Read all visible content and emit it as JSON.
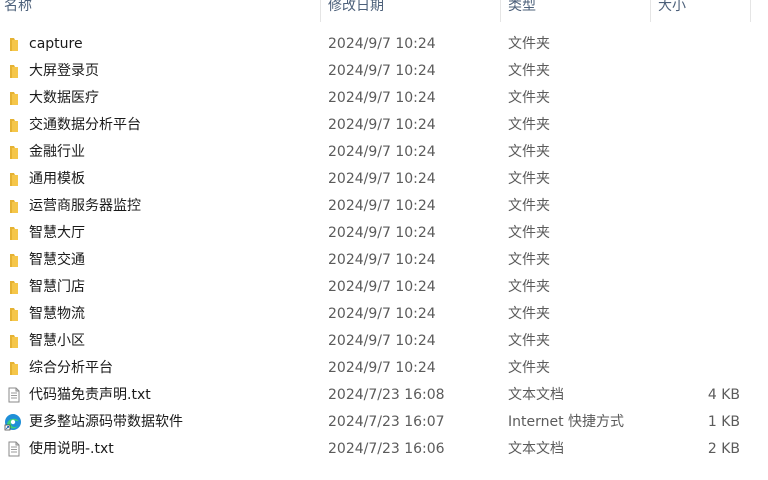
{
  "columns": {
    "name": "名称",
    "date": "修改日期",
    "type": "类型",
    "size": "大小"
  },
  "colors": {
    "folder": "#f5c64a",
    "folder_tab": "#e5b233",
    "header_text": "#4c607a",
    "secondary_text": "#5b5b5b"
  },
  "rows": [
    {
      "name": "capture",
      "date": "2024/9/7 10:24",
      "type": "文件夹",
      "size": "",
      "icon": "folder-icon"
    },
    {
      "name": "大屏登录页",
      "date": "2024/9/7 10:24",
      "type": "文件夹",
      "size": "",
      "icon": "folder-icon"
    },
    {
      "name": "大数据医疗",
      "date": "2024/9/7 10:24",
      "type": "文件夹",
      "size": "",
      "icon": "folder-icon"
    },
    {
      "name": "交通数据分析平台",
      "date": "2024/9/7 10:24",
      "type": "文件夹",
      "size": "",
      "icon": "folder-icon"
    },
    {
      "name": "金融行业",
      "date": "2024/9/7 10:24",
      "type": "文件夹",
      "size": "",
      "icon": "folder-icon"
    },
    {
      "name": "通用模板",
      "date": "2024/9/7 10:24",
      "type": "文件夹",
      "size": "",
      "icon": "folder-icon"
    },
    {
      "name": "运营商服务器监控",
      "date": "2024/9/7 10:24",
      "type": "文件夹",
      "size": "",
      "icon": "folder-icon"
    },
    {
      "name": "智慧大厅",
      "date": "2024/9/7 10:24",
      "type": "文件夹",
      "size": "",
      "icon": "folder-icon"
    },
    {
      "name": "智慧交通",
      "date": "2024/9/7 10:24",
      "type": "文件夹",
      "size": "",
      "icon": "folder-icon"
    },
    {
      "name": "智慧门店",
      "date": "2024/9/7 10:24",
      "type": "文件夹",
      "size": "",
      "icon": "folder-icon"
    },
    {
      "name": "智慧物流",
      "date": "2024/9/7 10:24",
      "type": "文件夹",
      "size": "",
      "icon": "folder-icon"
    },
    {
      "name": "智慧小区",
      "date": "2024/9/7 10:24",
      "type": "文件夹",
      "size": "",
      "icon": "folder-icon"
    },
    {
      "name": "综合分析平台",
      "date": "2024/9/7 10:24",
      "type": "文件夹",
      "size": "",
      "icon": "folder-icon"
    },
    {
      "name": "代码猫免责声明.txt",
      "date": "2024/7/23 16:08",
      "type": "文本文档",
      "size": "4 KB",
      "icon": "text-file-icon"
    },
    {
      "name": "更多整站源码带数据软件",
      "date": "2024/7/23 16:07",
      "type": "Internet 快捷方式",
      "size": "1 KB",
      "icon": "edge-shortcut-icon"
    },
    {
      "name": "使用说明-.txt",
      "date": "2024/7/23 16:06",
      "type": "文本文档",
      "size": "2 KB",
      "icon": "text-file-icon"
    }
  ]
}
